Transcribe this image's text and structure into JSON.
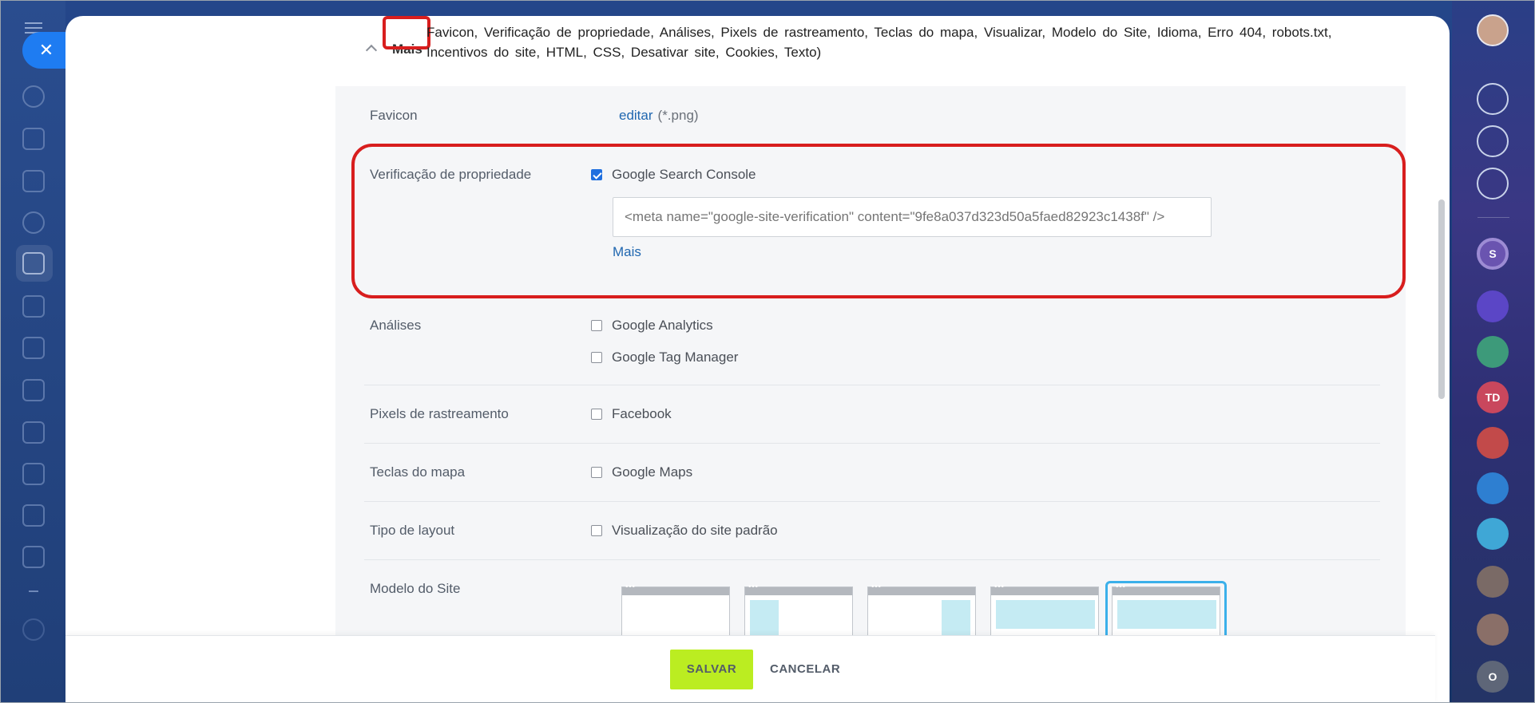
{
  "header": {
    "toggle_label": "Mais",
    "sections_list": "Favicon, Verificação de propriedade, Análises, Pixels de rastreamento, Teclas do mapa, Visualizar, Modelo do Site, Idioma, Erro 404, robots.txt, Incentivos do site, HTML, CSS, Desativar site, Cookies, Texto)"
  },
  "favicon": {
    "label": "Favicon",
    "edit_link": "editar",
    "hint": "(*.png)"
  },
  "verification": {
    "label": "Verificação de propriedade",
    "gsc_label": "Google Search Console",
    "gsc_checked": true,
    "meta_placeholder": "<meta name=\"google-site-verification\" content=\"9fe8a037d323d50a5faed82923c1438f\" />",
    "more_link": "Mais"
  },
  "analytics": {
    "label": "Análises",
    "options": [
      "Google Analytics",
      "Google Tag Manager"
    ]
  },
  "pixels": {
    "label": "Pixels de rastreamento",
    "facebook": "Facebook"
  },
  "map_keys": {
    "label": "Teclas do mapa",
    "google_maps": "Google Maps"
  },
  "layout_type": {
    "label": "Tipo de layout",
    "default_view": "Visualização do site padrão"
  },
  "site_template": {
    "label": "Modelo do Site",
    "selected_index": 4
  },
  "footer": {
    "save": "SALVAR",
    "cancel": "CANCELAR"
  },
  "right_rail": {
    "initials_s": "S",
    "initials_td": "TD",
    "initials_o": "O"
  },
  "colors": {
    "accent_blue": "#1e7cf2",
    "save_green": "#bbed21",
    "highlight_red": "#d81e1e",
    "link_blue": "#2067b0",
    "template_select": "#3bb0ea"
  }
}
